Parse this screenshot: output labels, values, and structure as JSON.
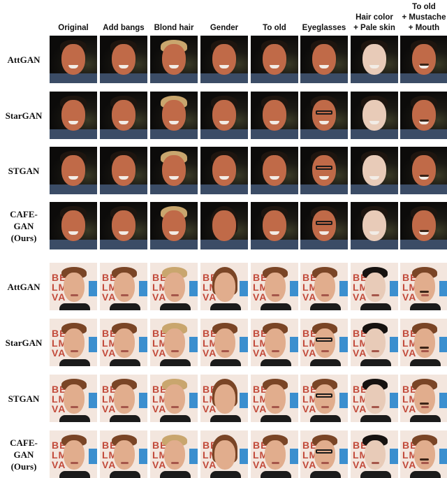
{
  "figure": {
    "columns": [
      "Original",
      "Add bangs",
      "Blond hair",
      "Gender",
      "To old",
      "Eyeglasses",
      "Hair color\n+ Pale skin",
      "To old\n+ Mustache\n+ Mouth"
    ],
    "groups": [
      {
        "subject": "dark-background-man",
        "rows": [
          {
            "method": "AttGAN"
          },
          {
            "method": "StarGAN"
          },
          {
            "method": "STGAN"
          },
          {
            "method": "CAFE-GAN\n(Ours)"
          }
        ]
      },
      {
        "subject": "light-background-man",
        "rows": [
          {
            "method": "AttGAN"
          },
          {
            "method": "StarGAN"
          },
          {
            "method": "STGAN"
          },
          {
            "method": "CAFE-GAN\n(Ours)"
          }
        ]
      }
    ],
    "backdrop_text": "BE\nLM\nVA"
  }
}
